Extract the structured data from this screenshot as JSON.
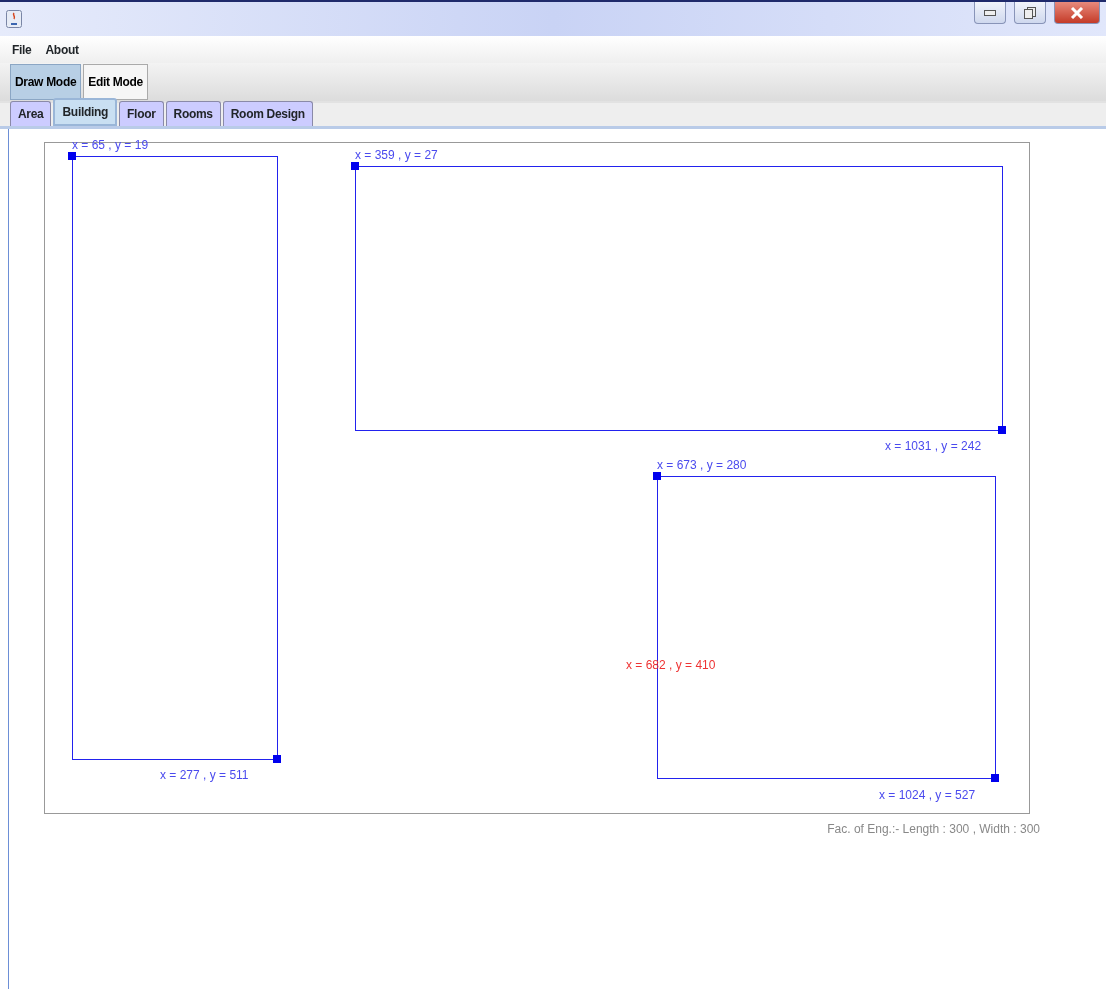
{
  "menu": [
    "File",
    "About"
  ],
  "modes": [
    {
      "label": "Draw Mode",
      "selected": true
    },
    {
      "label": "Edit Mode",
      "selected": false
    }
  ],
  "tabs": [
    {
      "label": "Area",
      "selected": false
    },
    {
      "label": "Building",
      "selected": true
    },
    {
      "label": "Floor",
      "selected": false
    },
    {
      "label": "Rooms",
      "selected": false
    },
    {
      "label": "Room Design",
      "selected": false
    }
  ],
  "canvas": {
    "shapes": [
      {
        "start_label": "x = 65 , y = 19",
        "end_label": "x = 277 , y = 511"
      },
      {
        "start_label": "x = 359 , y = 27",
        "end_label": "x = 1031 , y = 242"
      },
      {
        "start_label": "x = 673 , y = 280",
        "end_label": "x = 1024 , y = 527"
      }
    ],
    "cursor_label": "x = 682 , y = 410"
  },
  "caption": "Fac. of Eng.:- Length : 300 , Width : 300"
}
